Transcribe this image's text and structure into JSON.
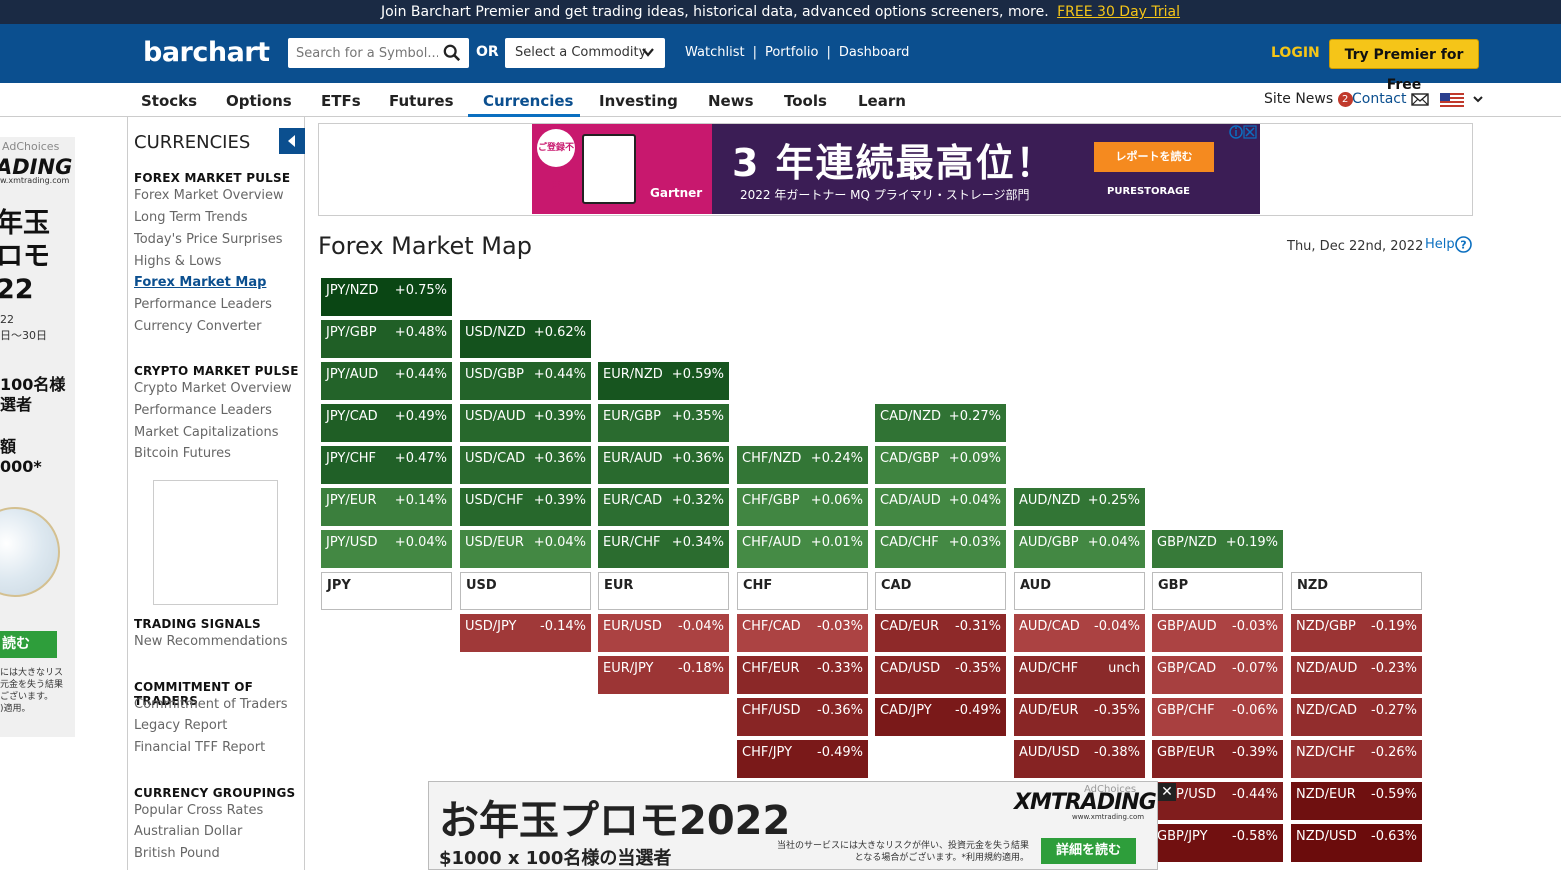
{
  "promo_bar": {
    "text": "Join Barchart Premier and get trading ideas, historical data, advanced options screeners, more.",
    "trial_link": "FREE 30 Day Trial"
  },
  "header": {
    "logo": "barchart",
    "search_placeholder": "Search for a Symbol...",
    "or_label": "OR",
    "commodity_select": "Select a Commodity",
    "links": [
      "Watchlist",
      "Portfolio",
      "Dashboard"
    ],
    "login": "LOGIN",
    "premier_button": "Try Premier for Free"
  },
  "nav": {
    "items": [
      "Stocks",
      "Options",
      "ETFs",
      "Futures",
      "Currencies",
      "Investing",
      "News",
      "Tools",
      "Learn"
    ],
    "active": "Currencies",
    "site_news": "Site News",
    "site_news_count": "2",
    "contact": "Contact"
  },
  "left_ad": {
    "adchoices": "AdChoices",
    "brand": "ADING",
    "url": "w.xmtrading.com",
    "headline": "年玉\nロモ\n22",
    "small": "22\n日〜30日",
    "mid": "100名様\n選者",
    "mid2": "額\n000*",
    "read_button": "読む",
    "disclaimer": "には大きなリス\n元金を失う結果\nございます。\n)適用。"
  },
  "sidebar": {
    "title": "CURRENCIES",
    "sections": [
      {
        "head": "FOREX MARKET PULSE",
        "links": [
          "Forex Market Overview",
          "Long Term Trends",
          "Today's Price Surprises",
          "Highs & Lows",
          "Forex Market Map",
          "Performance Leaders",
          "Currency Converter"
        ]
      },
      {
        "head": "CRYPTO MARKET PULSE",
        "links": [
          "Crypto Market Overview",
          "Performance Leaders",
          "Market Capitalizations",
          "Bitcoin Futures"
        ]
      },
      {
        "head": "TRADING SIGNALS",
        "links": [
          "New Recommendations"
        ]
      },
      {
        "head": "COMMITMENT OF TRADERS",
        "links": [
          "Commitment of Traders",
          "Legacy Report",
          "Financial TFF Report"
        ]
      },
      {
        "head": "CURRENCY GROUPINGS",
        "links": [
          "Popular Cross Rates",
          "Australian Dollar",
          "British Pound"
        ]
      }
    ],
    "active_link": "Forex Market Map"
  },
  "top_ad": {
    "badge": "ご登録不要",
    "gartner": "Gartner",
    "headline": "3 年連続最高位！",
    "sub": "2022 年ガートナー MQ プライマリ・ストレージ部門",
    "button": "レポートを読む",
    "brand": "PURESTORAGE"
  },
  "main": {
    "title": "Forex Market Map",
    "date": "Thu, Dec 22nd, 2022",
    "help": "Help"
  },
  "market_map": {
    "columns": [
      {
        "base": "JPY",
        "gainers": [
          [
            "JPY/NZD",
            "+0.75%"
          ],
          [
            "JPY/GBP",
            "+0.48%"
          ],
          [
            "JPY/AUD",
            "+0.44%"
          ],
          [
            "JPY/CAD",
            "+0.49%"
          ],
          [
            "JPY/CHF",
            "+0.47%"
          ],
          [
            "JPY/EUR",
            "+0.14%"
          ],
          [
            "JPY/USD",
            "+0.04%"
          ]
        ],
        "losers": []
      },
      {
        "base": "USD",
        "gainers": [
          [
            "USD/NZD",
            "+0.62%"
          ],
          [
            "USD/GBP",
            "+0.44%"
          ],
          [
            "USD/AUD",
            "+0.39%"
          ],
          [
            "USD/CAD",
            "+0.36%"
          ],
          [
            "USD/CHF",
            "+0.39%"
          ],
          [
            "USD/EUR",
            "+0.04%"
          ]
        ],
        "losers": [
          [
            "USD/JPY",
            "-0.14%"
          ]
        ]
      },
      {
        "base": "EUR",
        "gainers": [
          [
            "EUR/NZD",
            "+0.59%"
          ],
          [
            "EUR/GBP",
            "+0.35%"
          ],
          [
            "EUR/AUD",
            "+0.36%"
          ],
          [
            "EUR/CAD",
            "+0.32%"
          ],
          [
            "EUR/CHF",
            "+0.34%"
          ]
        ],
        "losers": [
          [
            "EUR/USD",
            "-0.04%"
          ],
          [
            "EUR/JPY",
            "-0.18%"
          ]
        ]
      },
      {
        "base": "CHF",
        "gainers": [
          [
            "CHF/NZD",
            "+0.24%"
          ],
          [
            "CHF/GBP",
            "+0.06%"
          ],
          [
            "CHF/AUD",
            "+0.01%"
          ]
        ],
        "losers": [
          [
            "CHF/CAD",
            "-0.03%"
          ],
          [
            "CHF/EUR",
            "-0.33%"
          ],
          [
            "CHF/USD",
            "-0.36%"
          ],
          [
            "CHF/JPY",
            "-0.49%"
          ]
        ]
      },
      {
        "base": "CAD",
        "gainers": [
          [
            "CAD/NZD",
            "+0.27%"
          ],
          [
            "CAD/GBP",
            "+0.09%"
          ],
          [
            "CAD/AUD",
            "+0.04%"
          ],
          [
            "CAD/CHF",
            "+0.03%"
          ]
        ],
        "losers": [
          [
            "CAD/EUR",
            "-0.31%"
          ],
          [
            "CAD/USD",
            "-0.35%"
          ],
          [
            "CAD/JPY",
            "-0.49%"
          ]
        ]
      },
      {
        "base": "AUD",
        "gainers": [
          [
            "AUD/NZD",
            "+0.25%"
          ],
          [
            "AUD/GBP",
            "+0.04%"
          ]
        ],
        "losers": [
          [
            "AUD/CAD",
            "-0.04%"
          ],
          [
            "AUD/CHF",
            "unch"
          ],
          [
            "AUD/EUR",
            "-0.35%"
          ],
          [
            "AUD/USD",
            "-0.38%"
          ]
        ]
      },
      {
        "base": "GBP",
        "gainers": [
          [
            "GBP/NZD",
            "+0.19%"
          ]
        ],
        "losers": [
          [
            "GBP/AUD",
            "-0.03%"
          ],
          [
            "GBP/CAD",
            "-0.07%"
          ],
          [
            "GBP/CHF",
            "-0.06%"
          ],
          [
            "GBP/EUR",
            "-0.39%"
          ],
          [
            "GBP/USD",
            "-0.44%"
          ],
          [
            "GBP/JPY",
            "-0.58%"
          ]
        ]
      },
      {
        "base": "NZD",
        "gainers": [],
        "losers": [
          [
            "NZD/GBP",
            "-0.19%"
          ],
          [
            "NZD/AUD",
            "-0.23%"
          ],
          [
            "NZD/CAD",
            "-0.27%"
          ],
          [
            "NZD/CHF",
            "-0.26%"
          ],
          [
            "NZD/EUR",
            "-0.59%"
          ],
          [
            "NZD/USD",
            "-0.63%"
          ]
        ]
      }
    ]
  },
  "bottom_ad": {
    "promo": "お年玉プロモ2022",
    "prize": "$1000 x 100名様の当選者",
    "brand": "XMTRADING",
    "url": "www.xmtrading.com",
    "adchoices": "AdChoices",
    "disclaimer": "当社のサービスには大きなリスクが伴い、投資元金を失う結果となる場合がございます。*利用規約適用。",
    "read_button": "詳細を読む",
    "close": "✕"
  }
}
